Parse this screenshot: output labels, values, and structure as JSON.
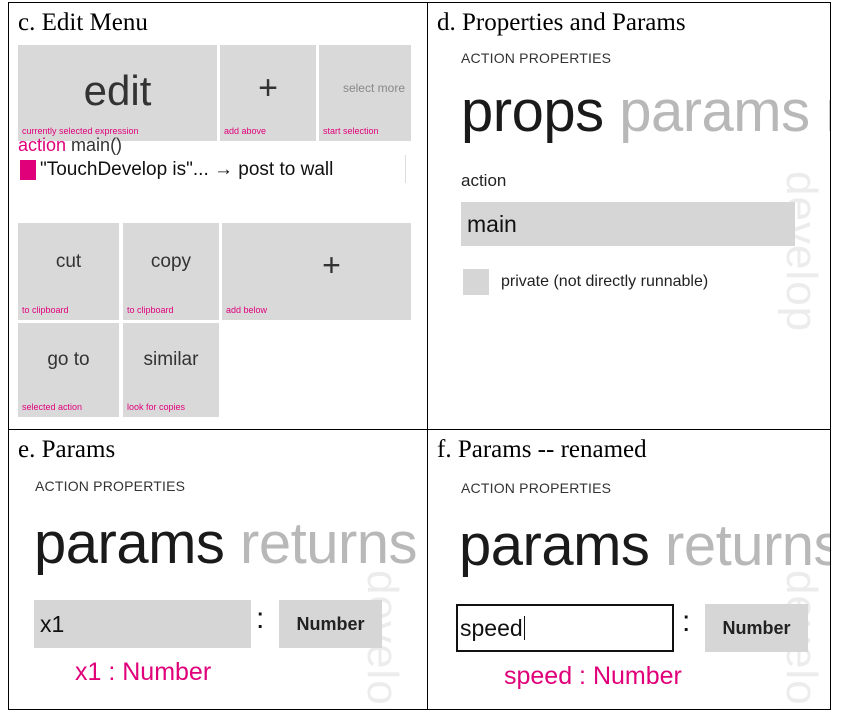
{
  "captions": {
    "c": "c. Edit Menu",
    "d": "d. Properties and Params",
    "e": "e. Params",
    "f": "f. Params -- renamed"
  },
  "edit_menu": {
    "edit": {
      "label": "edit",
      "hint": "currently selected expression"
    },
    "add_above": {
      "label": "+",
      "hint": "add above"
    },
    "select_more": {
      "label": "select more",
      "hint": "start selection"
    },
    "code_header_keyword": "action",
    "code_header_rest": " main()",
    "code_statement": "\"TouchDevelop is\"... → post to wall",
    "cut": {
      "label": "cut",
      "hint": "to clipboard"
    },
    "copy": {
      "label": "copy",
      "hint": "to clipboard"
    },
    "add_below": {
      "label": "+",
      "hint": "add below"
    },
    "go_to": {
      "label": "go to",
      "hint": "selected action"
    },
    "similar": {
      "label": "similar",
      "hint": "look for copies"
    }
  },
  "props_panel": {
    "subhead": "ACTION PROPERTIES",
    "pivot_active": "props",
    "pivot_inactive": "params",
    "pivot_overflow": "r",
    "field_label": "action",
    "action_name": "main",
    "private_label": "private (not directly runnable)",
    "private_checked": false,
    "watermark": "develop"
  },
  "params_panel": {
    "subhead": "ACTION PROPERTIES",
    "pivot_active": "params",
    "pivot_inactive": "returns",
    "param_name": "x1",
    "colon": ":",
    "param_type": "Number",
    "signature": "x1 : Number",
    "watermark": "develop"
  },
  "params_renamed_panel": {
    "subhead": "ACTION PROPERTIES",
    "pivot_active": "params",
    "pivot_inactive": "returns",
    "param_name": "speed",
    "colon": ":",
    "param_type": "Number",
    "signature": "speed : Number",
    "watermark": "develop"
  },
  "colors": {
    "accent": "#e0007a",
    "tile": "#d9d9d9",
    "inactive_text": "#b8b8b8"
  }
}
